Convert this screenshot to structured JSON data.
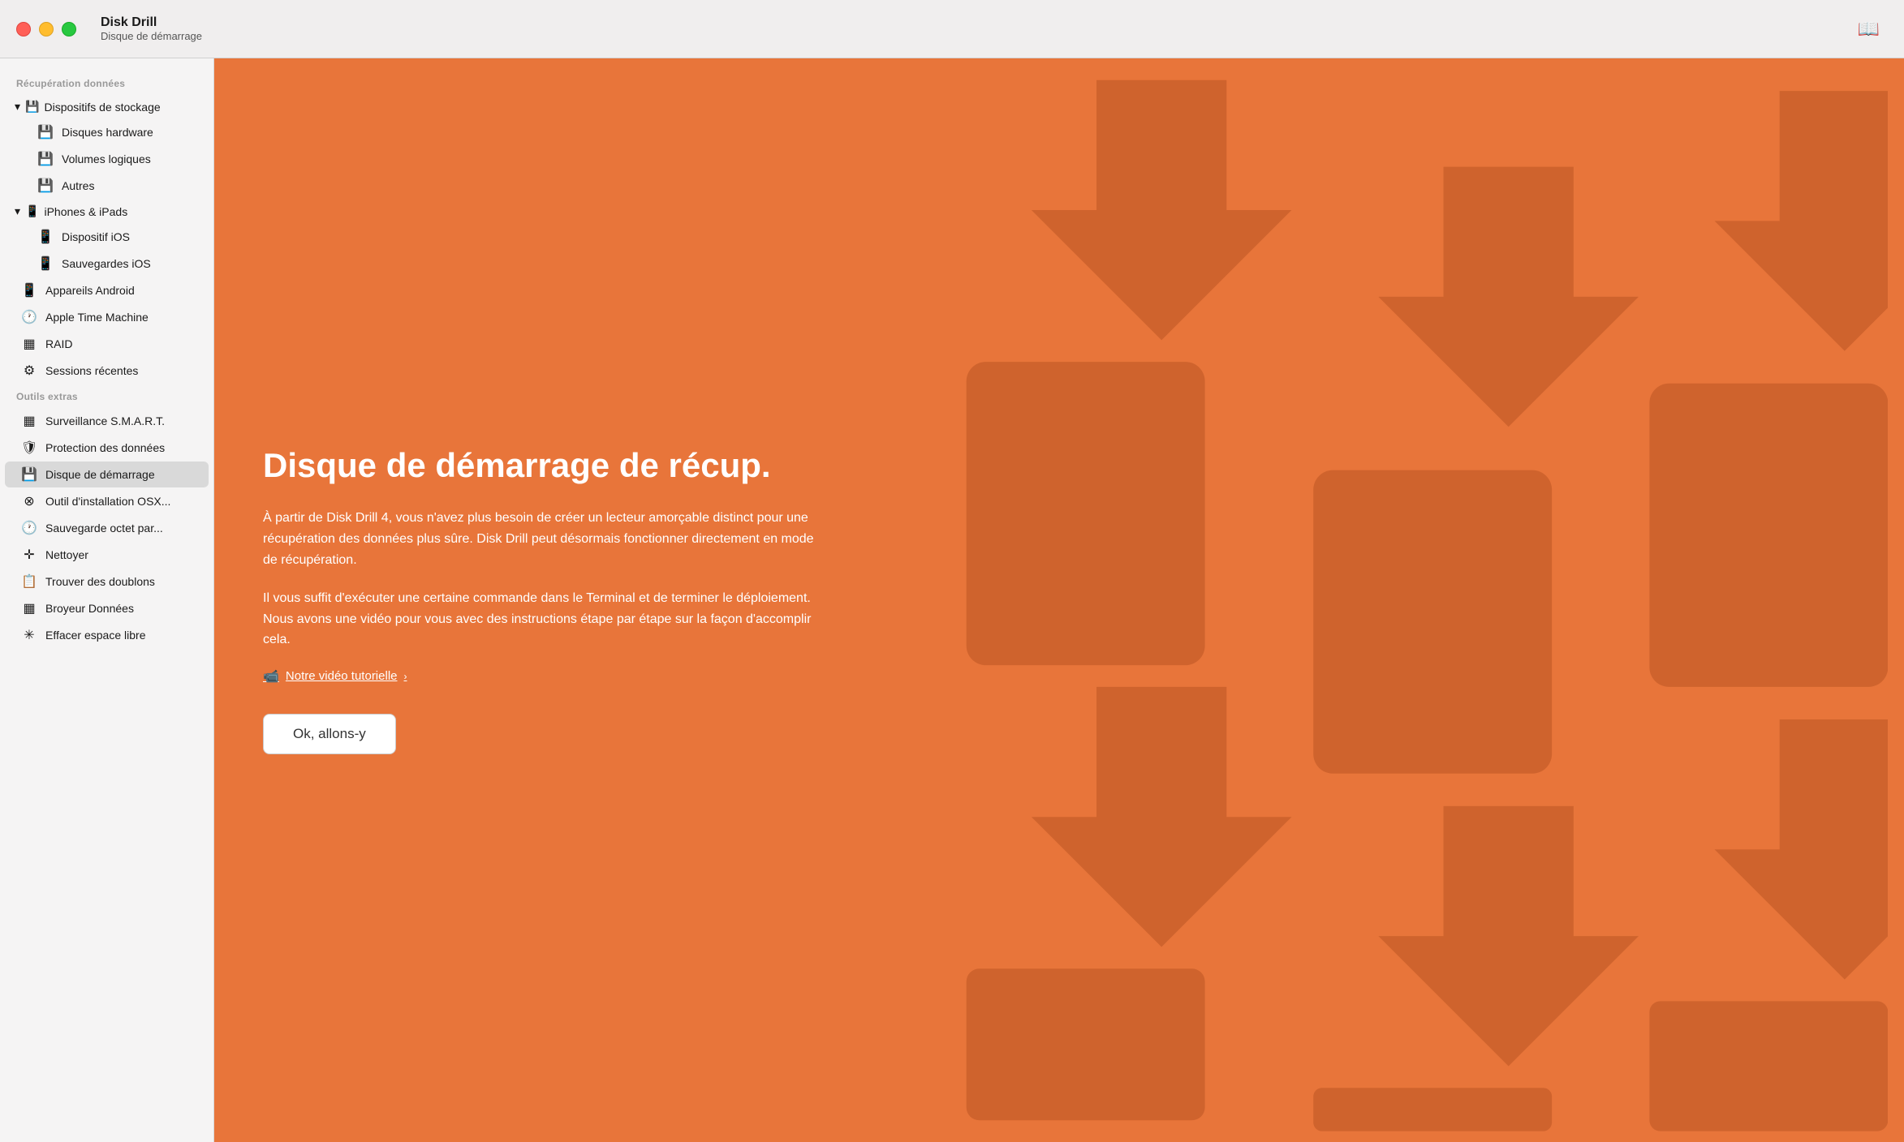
{
  "titlebar": {
    "app_name": "Disk Drill",
    "subtitle": "Disque de démarrage",
    "book_icon": "📖"
  },
  "sidebar": {
    "section1_label": "Récupération données",
    "group_storage": {
      "label": "Dispositifs de stockage",
      "chevron": "▾",
      "children": [
        {
          "label": "Disques hardware",
          "icon": "💾"
        },
        {
          "label": "Volumes logiques",
          "icon": "💾"
        },
        {
          "label": "Autres",
          "icon": "💾"
        }
      ]
    },
    "group_ios": {
      "label": "iPhones & iPads",
      "chevron": "▾",
      "children": [
        {
          "label": "Dispositif iOS",
          "icon": "📱"
        },
        {
          "label": "Sauvegardes iOS",
          "icon": "📱"
        }
      ]
    },
    "items_top": [
      {
        "label": "Appareils Android",
        "icon": "📱"
      },
      {
        "label": "Apple Time Machine",
        "icon": "🕐"
      },
      {
        "label": "RAID",
        "icon": "▦"
      },
      {
        "label": "Sessions récentes",
        "icon": "⚙"
      }
    ],
    "section2_label": "Outils extras",
    "items_extras": [
      {
        "label": "Surveillance S.M.A.R.T.",
        "icon": "▦"
      },
      {
        "label": "Protection des données",
        "icon": "🛡"
      },
      {
        "label": "Disque de démarrage",
        "icon": "💾",
        "active": true
      },
      {
        "label": "Outil d'installation OSX...",
        "icon": "⊗"
      },
      {
        "label": "Sauvegarde octet par...",
        "icon": "🕐"
      },
      {
        "label": "Nettoyer",
        "icon": "✛"
      },
      {
        "label": "Trouver des doublons",
        "icon": "📋"
      },
      {
        "label": "Broyeur Données",
        "icon": "▦"
      },
      {
        "label": "Effacer espace libre",
        "icon": "✳"
      }
    ]
  },
  "content": {
    "title": "Disque de démarrage de récup.",
    "para1": "À partir de Disk Drill 4, vous n'avez plus besoin de créer un lecteur amorçable distinct pour une récupération des données plus sûre. Disk Drill peut désormais fonctionner directement en mode de récupération.",
    "para2": "Il vous suffit d'exécuter une certaine commande dans le Terminal et de terminer le déploiement. Nous avons une vidéo pour vous avec des instructions étape par étape sur la façon d'accomplir cela.",
    "video_link": "Notre vidéo tutorielle",
    "video_link_chevron": "›",
    "button_label": "Ok, allons-y"
  }
}
